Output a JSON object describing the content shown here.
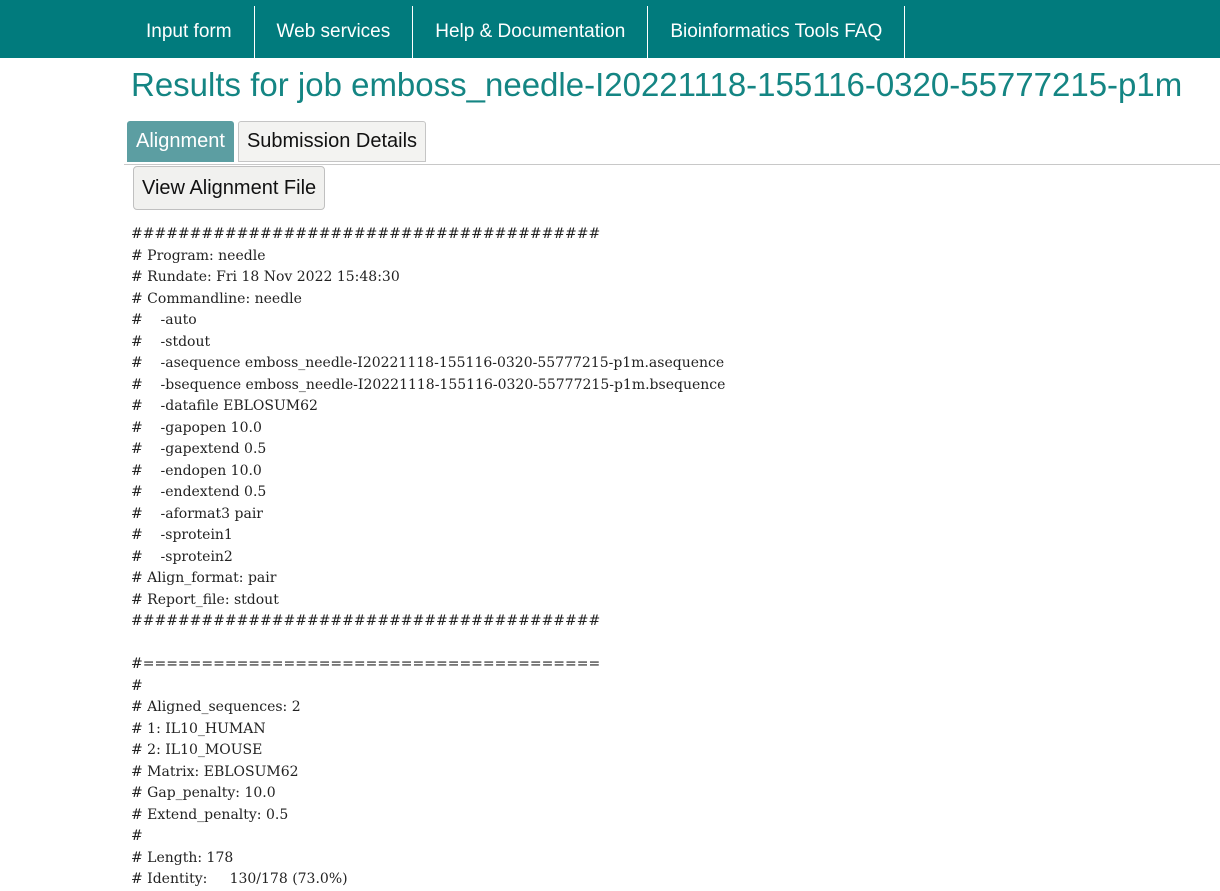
{
  "nav": {
    "items": [
      {
        "label": "Input form"
      },
      {
        "label": "Web services"
      },
      {
        "label": "Help & Documentation"
      },
      {
        "label": "Bioinformatics Tools FAQ"
      }
    ]
  },
  "page": {
    "title": "Results for job emboss_needle-I20221118-155116-0320-55777215-p1m"
  },
  "tabs": [
    {
      "label": "Alignment",
      "active": true
    },
    {
      "label": "Submission Details",
      "active": false
    }
  ],
  "buttons": {
    "view_alignment_file": "View Alignment File"
  },
  "output": {
    "lines": [
      "########################################",
      "# Program: needle",
      "# Rundate: Fri 18 Nov 2022 15:48:30",
      "# Commandline: needle",
      "#    -auto",
      "#    -stdout",
      "#    -asequence emboss_needle-I20221118-155116-0320-55777215-p1m.asequence",
      "#    -bsequence emboss_needle-I20221118-155116-0320-55777215-p1m.bsequence",
      "#    -datafile EBLOSUM62",
      "#    -gapopen 10.0",
      "#    -gapextend 0.5",
      "#    -endopen 10.0",
      "#    -endextend 0.5",
      "#    -aformat3 pair",
      "#    -sprotein1",
      "#    -sprotein2",
      "# Align_format: pair",
      "# Report_file: stdout",
      "########################################",
      "",
      "#=======================================",
      "#",
      "# Aligned_sequences: 2",
      "# 1: IL10_HUMAN",
      "# 2: IL10_MOUSE",
      "# Matrix: EBLOSUM62",
      "# Gap_penalty: 10.0",
      "# Extend_penalty: 0.5",
      "#",
      "# Length: 178",
      "# Identity:     130/178 (73.0%)"
    ]
  }
}
